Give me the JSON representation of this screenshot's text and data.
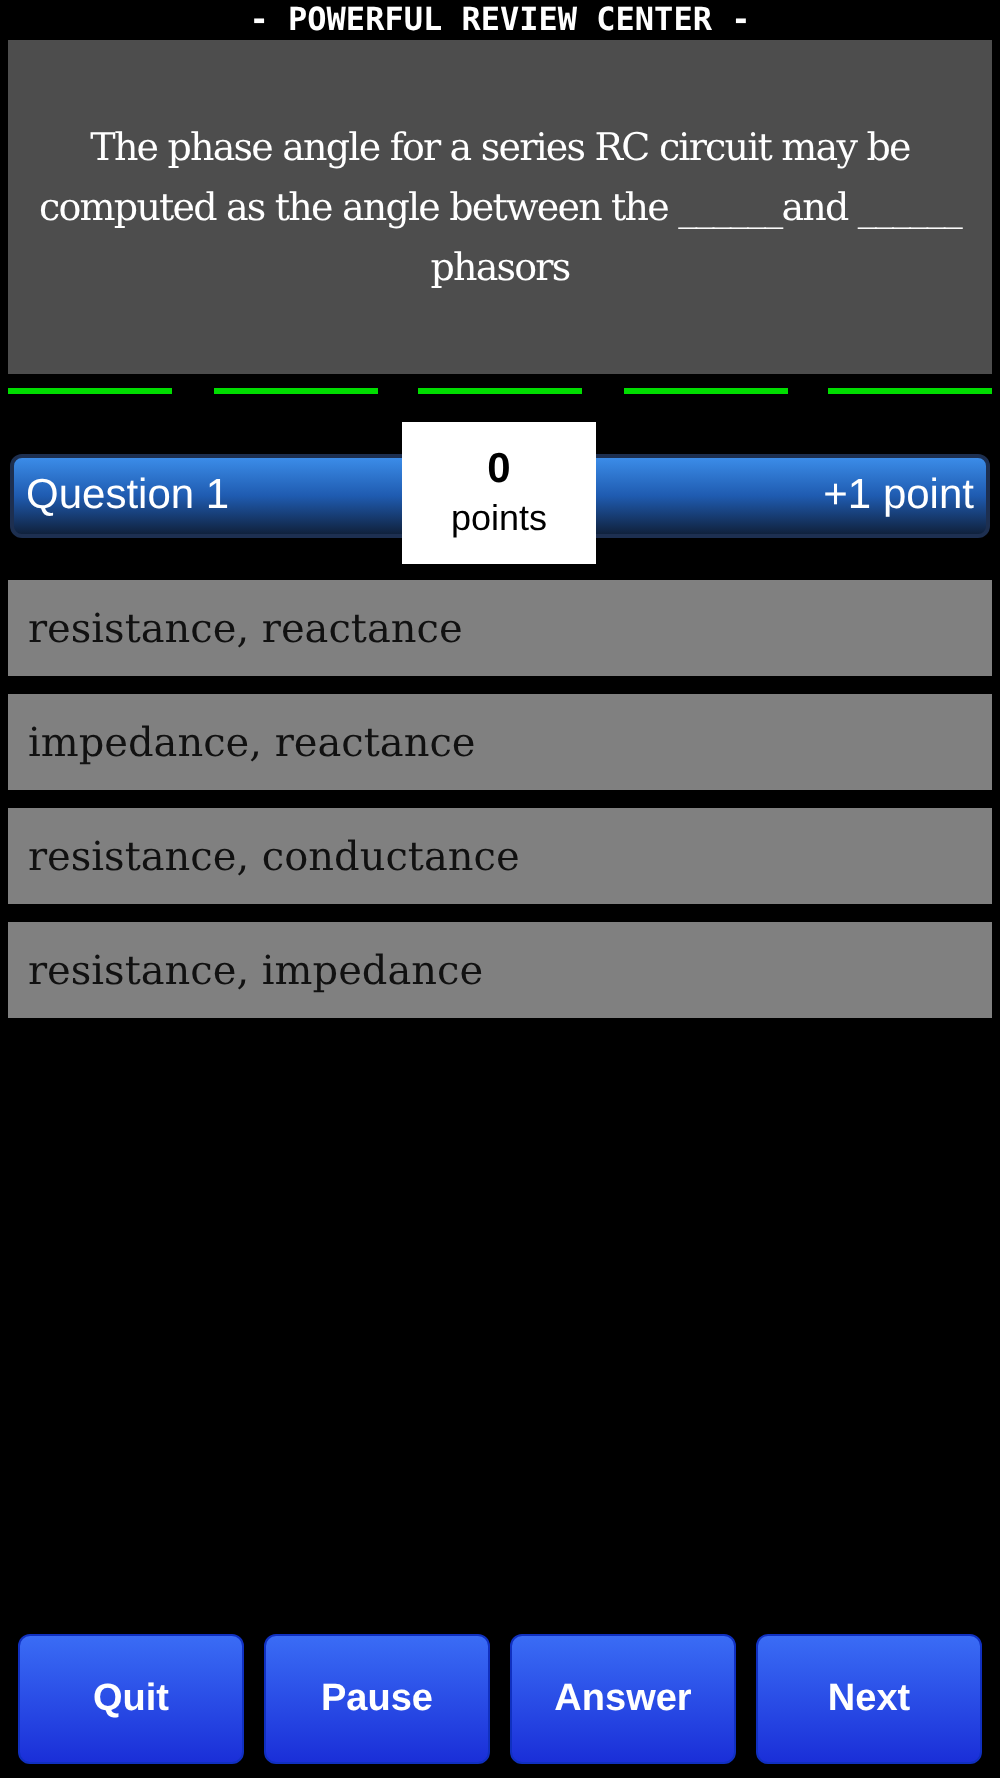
{
  "header": {
    "title": "- POWERFUL REVIEW CENTER -"
  },
  "question": {
    "text": "The phase angle for a series RC circuit may be computed as the angle between the ______and ______ phasors"
  },
  "score_bar": {
    "question_label": "Question 1",
    "score": "0",
    "score_unit": "points",
    "point_value": "+1 point"
  },
  "options": [
    {
      "text": "resistance, reactance"
    },
    {
      "text": "impedance, reactance"
    },
    {
      "text": "resistance, conductance"
    },
    {
      "text": "resistance, impedance"
    }
  ],
  "buttons": [
    "Quit",
    "Pause",
    "Answer",
    "Next"
  ]
}
